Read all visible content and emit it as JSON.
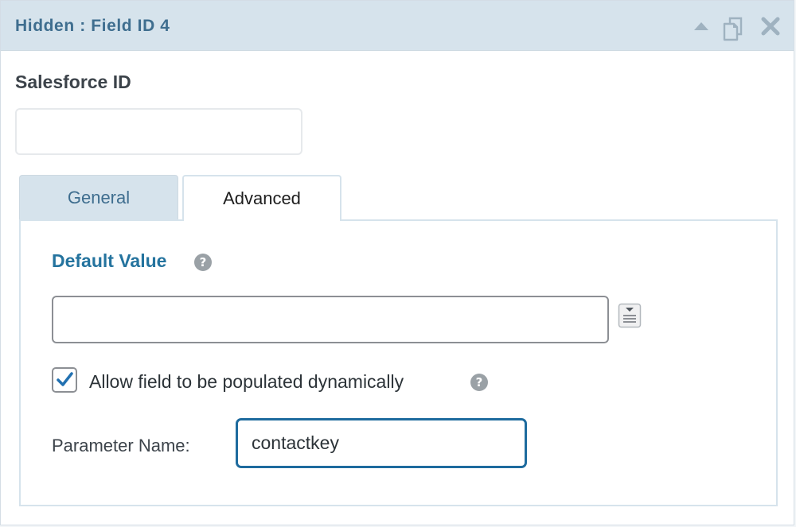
{
  "header": {
    "title": "Hidden : Field ID 4",
    "icons": [
      "collapse-icon",
      "duplicate-icon",
      "delete-icon"
    ]
  },
  "field": {
    "label": "Salesforce ID",
    "value": ""
  },
  "tabs": [
    {
      "label": "General",
      "active": false
    },
    {
      "label": "Advanced",
      "active": true
    }
  ],
  "advanced": {
    "default_value_label": "Default Value",
    "default_value": "",
    "help_glyph": "?",
    "dynamic_checkbox_label": "Allow field to be populated dynamically",
    "dynamic_checked": true,
    "param_name_label": "Parameter Name:",
    "param_name_value": "contactkey"
  },
  "colors": {
    "header_bg": "#d6e3ec",
    "title": "#3f6e8f",
    "accent": "#24739e",
    "focus_border": "#1e6b9e"
  }
}
